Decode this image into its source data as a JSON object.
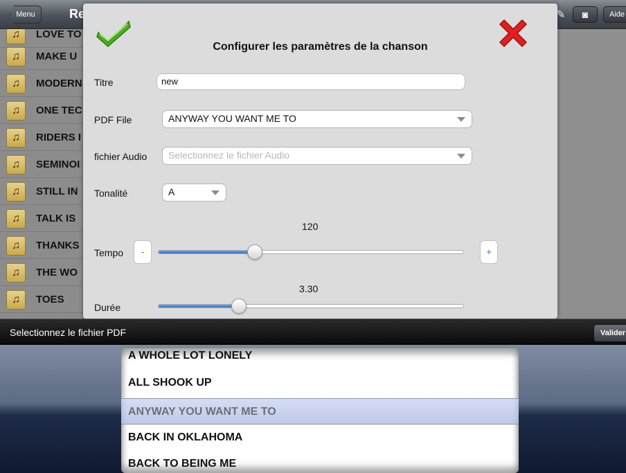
{
  "topbar": {
    "menu_label": "Menu",
    "title_partial": "Re",
    "aide_label": "Aide"
  },
  "song_list": {
    "items": [
      {
        "name": "LOVE TO"
      },
      {
        "name": "MAKE U"
      },
      {
        "name": "MODERN"
      },
      {
        "name": "ONE TEC"
      },
      {
        "name": "RIDERS I"
      },
      {
        "name": "SEMINOI"
      },
      {
        "name": "STILL IN"
      },
      {
        "name": "TALK IS"
      },
      {
        "name": "THANKS"
      },
      {
        "name": "THE WO"
      },
      {
        "name": "TOES"
      }
    ]
  },
  "modal": {
    "title": "Configurer les paramètres de la chanson",
    "titre_label": "Titre",
    "titre_value": "new",
    "pdf_label": "PDF File",
    "pdf_value": "ANYWAY YOU WANT ME TO",
    "audio_label": "fichier Audio",
    "audio_placeholder": "Selectionnez le fichier Audio",
    "tonalite_label": "Tonalité",
    "tonalite_value": "A",
    "tempo_label": "Tempo",
    "tempo_value": "120",
    "tempo_minus": "-",
    "tempo_plus": "+",
    "duree_label": "Durée",
    "duree_value": "3.30"
  },
  "picker": {
    "title": "Selectionnez le fichier PDF",
    "valider_label": "Valider",
    "items": [
      {
        "label": "A WHOLE LOT LONELY"
      },
      {
        "label": "ALL SHOOK UP"
      },
      {
        "label": "ANYWAY YOU WANT ME TO"
      },
      {
        "label": "BACK IN OKLAHOMA"
      },
      {
        "label": "BACK TO BEING ME"
      }
    ],
    "selected_index": 2
  },
  "colors": {
    "accent_blue": "#2f6fd0",
    "check_green": "#4caf1f",
    "close_red": "#e02020"
  }
}
